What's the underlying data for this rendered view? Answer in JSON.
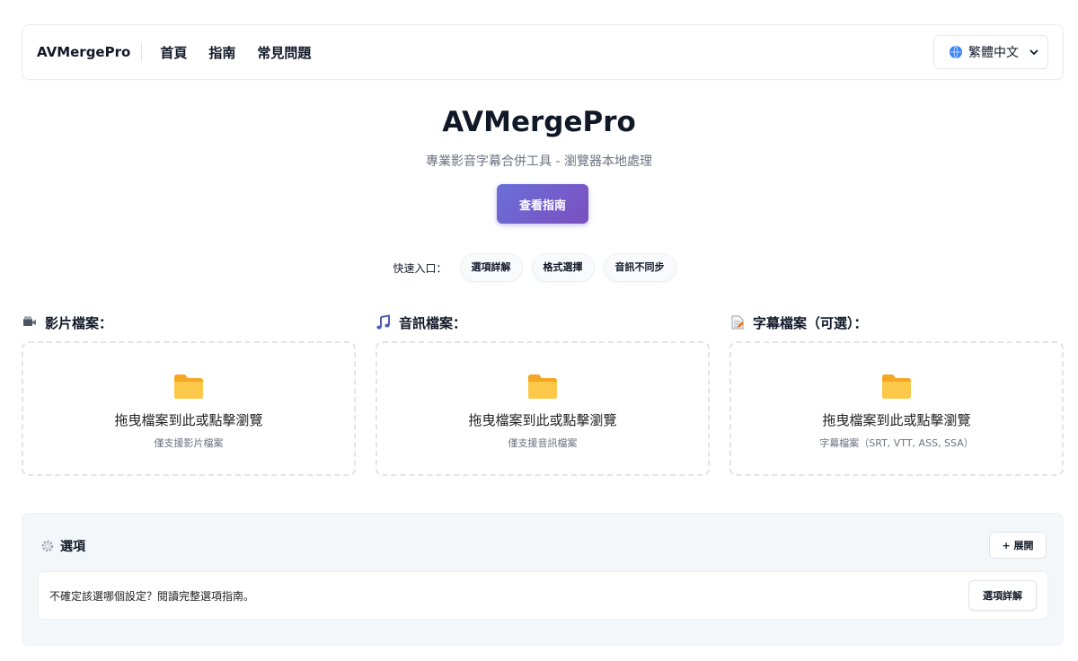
{
  "navbar": {
    "brand": "AVMergePro",
    "links": [
      "首頁",
      "指南",
      "常見問題"
    ],
    "language": {
      "selected": "繁體中文",
      "icon": "globe-icon"
    }
  },
  "hero": {
    "title": "AVMergePro",
    "subtitle": "專業影音字幕合併工具 - 瀏覽器本地處理",
    "guide_button": "查看指南"
  },
  "quick_links": {
    "label": "快速入口：",
    "items": [
      "選項詳解",
      "格式選擇",
      "音訊不同步"
    ]
  },
  "uploads": [
    {
      "label": "影片檔案：",
      "icon": "video-camera-icon",
      "drop_text": "拖曳檔案到此或點擊瀏覽",
      "hint": "僅支援影片檔案"
    },
    {
      "label": "音訊檔案：",
      "icon": "music-note-icon",
      "drop_text": "拖曳檔案到此或點擊瀏覽",
      "hint": "僅支援音訊檔案"
    },
    {
      "label": "字幕檔案（可選）：",
      "icon": "document-icon",
      "drop_text": "拖曳檔案到此或點擊瀏覽",
      "hint": "字幕檔案（SRT, VTT, ASS, SSA）"
    }
  ],
  "options": {
    "title": "選項",
    "expand_button": "+ 展開",
    "help_text": "不確定該選哪個設定？閱讀完整選項指南。",
    "help_button": "選項詳解"
  },
  "colors": {
    "accent_start": "#6a6fd9",
    "accent_end": "#7b4fbf",
    "folder": "#fbbf3a",
    "panel_bg": "#f4f7fa"
  }
}
